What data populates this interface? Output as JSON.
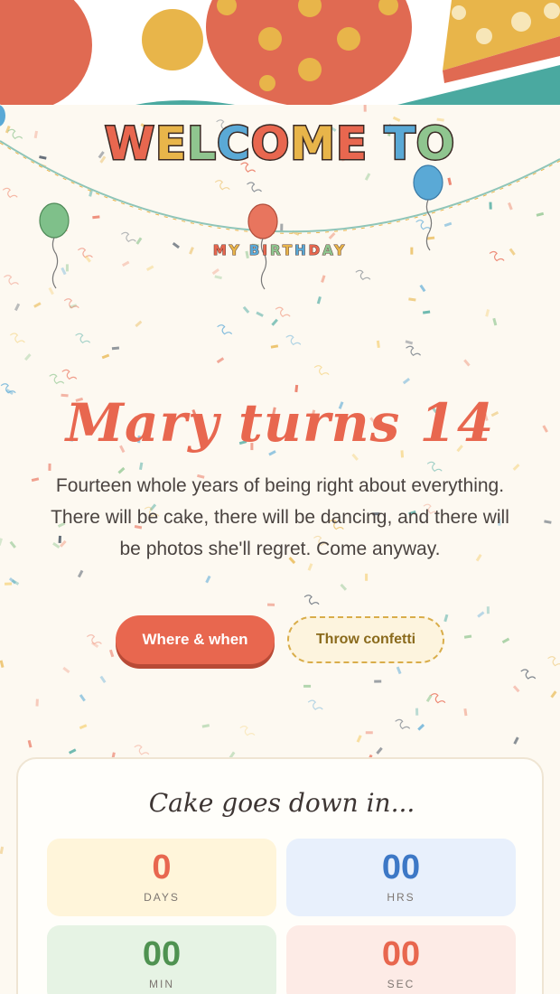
{
  "welcome": {
    "letters": [
      "W",
      "E",
      "L",
      "C",
      "O",
      "M",
      "E",
      " ",
      "T",
      "O"
    ],
    "letter_colors": [
      "#e8674f",
      "#e8b54a",
      "#8fc58f",
      "#5aa9d6",
      "#e8674f",
      "#e8b54a",
      "#e8674f",
      "#ffffff",
      "#5aa9d6",
      "#8fc58f"
    ]
  },
  "banner": {
    "letters": [
      "M",
      "Y",
      " ",
      "B",
      "I",
      "R",
      "T",
      "H",
      "D",
      "A",
      "Y"
    ],
    "letter_colors": [
      "#e8674f",
      "#e8b54a",
      "#ffffff",
      "#5aa9d6",
      "#e8674f",
      "#8fc58f",
      "#e8b54a",
      "#5aa9d6",
      "#e8674f",
      "#8fc58f",
      "#e8b54a"
    ]
  },
  "hero": {
    "title": "Mary turns 14",
    "intro": "Fourteen whole years of being right about everything. There will be cake, there will be dancing, and there will be photos she'll regret. Come anyway."
  },
  "actions": {
    "primary_label": "Where & when",
    "secondary_label": "Throw confetti"
  },
  "countdown": {
    "title": "Cake goes down in...",
    "days_value": "0",
    "days_label": "DAYS",
    "hrs_value": "00",
    "hrs_label": "HRS",
    "min_value": "00",
    "min_label": "MIN",
    "sec_value": "00",
    "sec_label": "SEC"
  },
  "palette": {
    "coral": "#e8674f",
    "mustard": "#e8b54a",
    "sky": "#5aa9d6",
    "mint": "#8fc58f",
    "teal": "#4aa9a0",
    "cream": "#fdf9f1"
  }
}
